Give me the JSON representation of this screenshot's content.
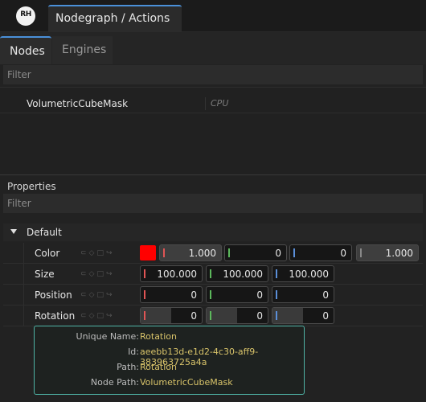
{
  "app": {
    "logo_text": "RH",
    "window_title": "Nodegraph / Actions",
    "accent_color": "#4a90d9"
  },
  "tabs": [
    {
      "label": "Nodes",
      "active": true
    },
    {
      "label": "Engines",
      "active": false
    }
  ],
  "nodes": {
    "filter_placeholder": "Filter",
    "rows": [
      {
        "name": "VolumetricCubeMask",
        "engine": "CPU"
      }
    ]
  },
  "properties": {
    "title": "Properties",
    "filter_placeholder": "Filter",
    "group": {
      "label": "Default",
      "expanded": true
    },
    "rows": [
      {
        "name": "Color",
        "swatch": "#ff0000",
        "values": [
          "1.000",
          "0",
          "0",
          "1.000"
        ],
        "channel_colors": [
          "#e05555",
          "#5cb85c",
          "#5b8fd9",
          "#888888"
        ]
      },
      {
        "name": "Size",
        "values": [
          "100.000",
          "100.000",
          "100.000"
        ],
        "channel_colors": [
          "#e05555",
          "#5cb85c",
          "#5b8fd9"
        ]
      },
      {
        "name": "Position",
        "values": [
          "0",
          "0",
          "0"
        ],
        "channel_colors": [
          "#e05555",
          "#5cb85c",
          "#5b8fd9"
        ]
      },
      {
        "name": "Rotation",
        "values": [
          "0",
          "0",
          "0"
        ],
        "channel_colors": [
          "#e05555",
          "#5cb85c",
          "#5b8fd9"
        ]
      }
    ],
    "row_icons": [
      "link-icon",
      "keyframe-icon",
      "square-icon",
      "arrow-icon"
    ]
  },
  "tooltip": {
    "rows": [
      {
        "key": "Unique Name:",
        "value": "Rotation"
      },
      {
        "key": "Id:",
        "value": "aeebb13d-e1d2-4c30-aff9-383963725a4a"
      },
      {
        "key": "Path:",
        "value": "Rotation"
      },
      {
        "key": "Node Path:",
        "value": "VolumetricCubeMask"
      }
    ],
    "border_color": "#4fb3a6",
    "value_color": "#d9c46a"
  }
}
